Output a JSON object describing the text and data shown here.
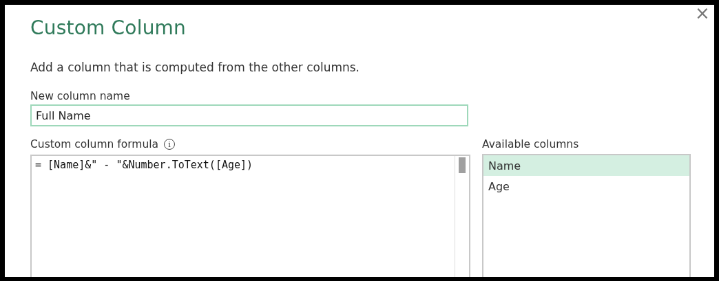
{
  "window": {
    "title": "Custom Column",
    "close": "×"
  },
  "description": "Add a column that is computed from the other columns.",
  "new_column_name": {
    "label": "New column name",
    "value": "Full Name"
  },
  "formula": {
    "label": "Custom column formula",
    "info": "i",
    "value": "= [Name]&\" - \"&Number.ToText([Age])"
  },
  "available_columns": {
    "label": "Available columns",
    "items": [
      {
        "label": "Name",
        "selected": true
      },
      {
        "label": "Age",
        "selected": false
      }
    ]
  }
}
